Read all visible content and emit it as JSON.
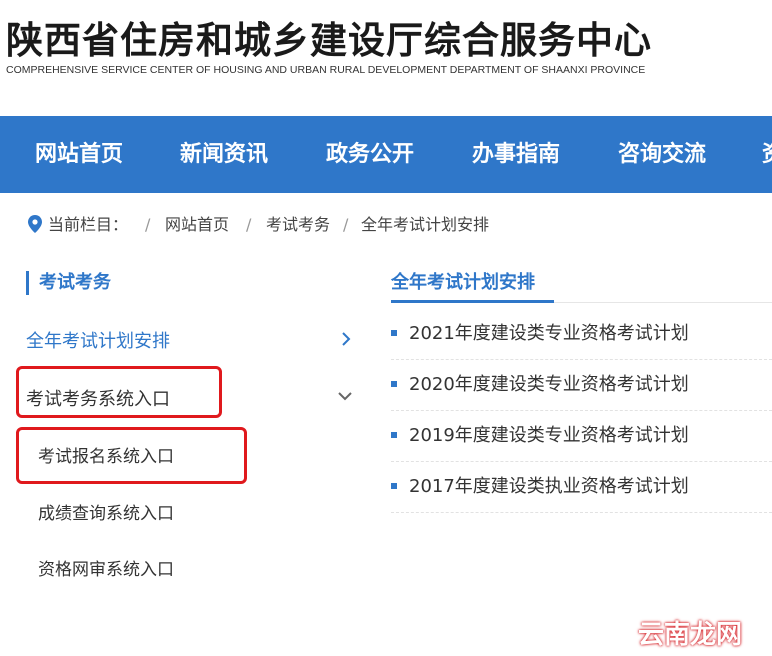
{
  "header": {
    "title": "陕西省住房和城乡建设厅综合服务中心",
    "subtitle": "COMPREHENSIVE SERVICE CENTER OF HOUSING AND URBAN RURAL DEVELOPMENT DEPARTMENT OF SHAANXI PROVINCE"
  },
  "nav": {
    "items": [
      "网站首页",
      "新闻资讯",
      "政务公开",
      "办事指南",
      "咨询交流",
      "资"
    ]
  },
  "breadcrumb": {
    "label": "当前栏目：",
    "sep": "/",
    "items": [
      "网站首页",
      "考试考务",
      "全年考试计划安排"
    ]
  },
  "sidebar": {
    "title": "考试考务",
    "items": [
      {
        "label": "全年考试计划安排",
        "color": "#2f77c9"
      },
      {
        "label": "考试考务系统入口",
        "color": "#333333"
      },
      {
        "label": "考试报名系统入口",
        "color": "#333333"
      },
      {
        "label": "成绩查询系统入口",
        "color": "#333333"
      },
      {
        "label": "资格网审系统入口",
        "color": "#333333"
      }
    ]
  },
  "main": {
    "title": "全年考试计划安排",
    "items": [
      "2021年度建设类专业资格考试计划",
      "2020年度建设类专业资格考试计划",
      "2019年度建设类专业资格考试计划",
      "2017年度建设类执业资格考试计划"
    ]
  },
  "watermark": "云南龙网",
  "colors": {
    "accent": "#2f77c9",
    "highlight": "#e0191d"
  }
}
